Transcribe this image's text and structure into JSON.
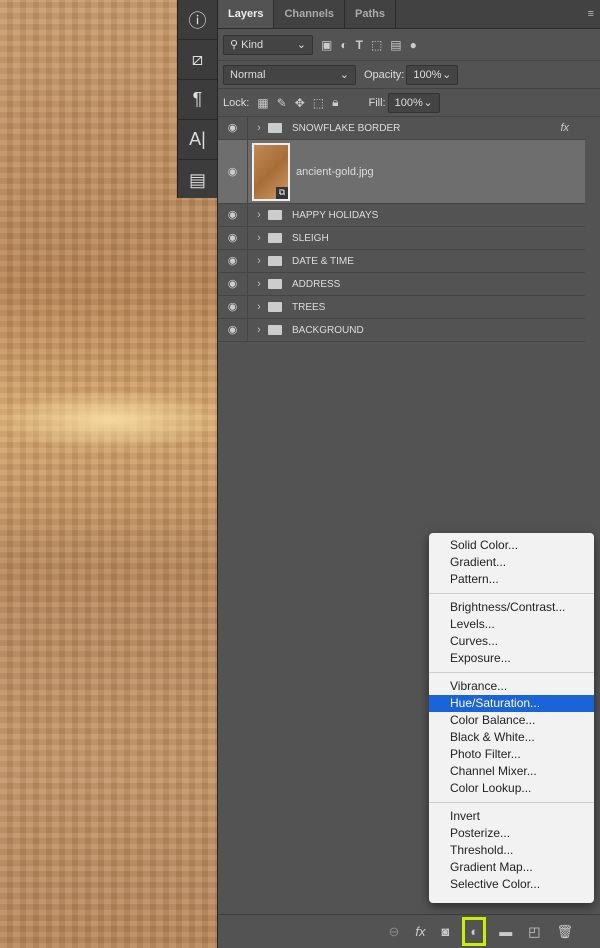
{
  "tabs": [
    "Layers",
    "Channels",
    "Paths"
  ],
  "filter": {
    "kind": "Kind"
  },
  "blend": {
    "mode": "Normal",
    "opacity_label": "Opacity:",
    "opacity": "100%"
  },
  "lock": {
    "label": "Lock:",
    "fill_label": "Fill:",
    "fill": "100%"
  },
  "layers": [
    {
      "name": "SNOWFLAKE BORDER",
      "type": "group",
      "fx": "fx"
    },
    {
      "name": "ancient-gold.jpg",
      "type": "smart-object",
      "selected": true
    },
    {
      "name": "HAPPY HOLIDAYS",
      "type": "group"
    },
    {
      "name": "SLEIGH",
      "type": "group"
    },
    {
      "name": "DATE & TIME",
      "type": "group"
    },
    {
      "name": "ADDRESS",
      "type": "group"
    },
    {
      "name": "TREES",
      "type": "group"
    },
    {
      "name": "BACKGROUND",
      "type": "group"
    }
  ],
  "menu": {
    "groups": [
      [
        "Solid Color...",
        "Gradient...",
        "Pattern..."
      ],
      [
        "Brightness/Contrast...",
        "Levels...",
        "Curves...",
        "Exposure..."
      ],
      [
        "Vibrance...",
        "Hue/Saturation...",
        "Color Balance...",
        "Black & White...",
        "Photo Filter...",
        "Channel Mixer...",
        "Color Lookup..."
      ],
      [
        "Invert",
        "Posterize...",
        "Threshold...",
        "Gradient Map...",
        "Selective Color..."
      ]
    ],
    "highlighted": "Hue/Saturation..."
  },
  "footer": {
    "fx": "fx"
  },
  "colors": {
    "highlight_outline": "#c8f000",
    "menu_selection": "#1a63d8"
  }
}
